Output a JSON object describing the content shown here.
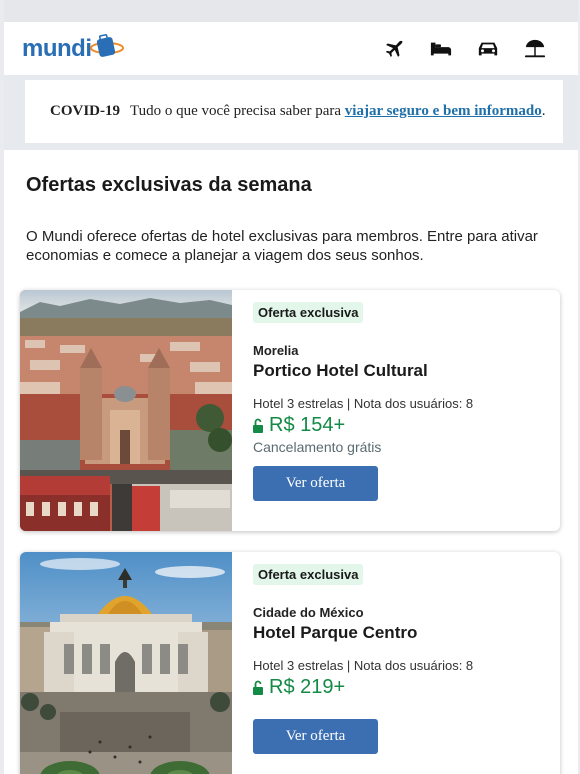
{
  "brand": {
    "logo_text": "mundi",
    "color": "#2a6fb6"
  },
  "nav": {
    "items": [
      {
        "icon": "airplane-icon"
      },
      {
        "icon": "bed-icon"
      },
      {
        "icon": "car-icon"
      },
      {
        "icon": "beach-umbrella-icon"
      }
    ]
  },
  "covid": {
    "label": "COVID-19",
    "text": "Tudo o que você precisa saber para",
    "link": "viajar seguro e bem informado",
    "suffix": "."
  },
  "main": {
    "title": "Ofertas exclusivas da semana",
    "intro": "O Mundi oferece ofertas de hotel exclusivas para membros. Entre para ativar economias e comece a planejar a viagem dos seus sonhos."
  },
  "offers": [
    {
      "badge": "Oferta exclusiva",
      "city": "Morelia",
      "hotel": "Portico Hotel Cultural",
      "meta": "Hotel 3 estrelas | Nota dos usuários: 8",
      "price": "R$ 154+",
      "cancel": "Cancelamento grátis",
      "button": "Ver oferta"
    },
    {
      "badge": "Oferta exclusiva",
      "city": "Cidade do México",
      "hotel": "Hotel Parque Centro",
      "meta": "Hotel 3 estrelas | Nota dos usuários: 8",
      "price": "R$ 219+",
      "cancel": "",
      "button": "Ver oferta"
    }
  ],
  "colors": {
    "accent": "#3b6fb2",
    "price": "#138a45",
    "badge_bg": "#e3f6ea"
  }
}
